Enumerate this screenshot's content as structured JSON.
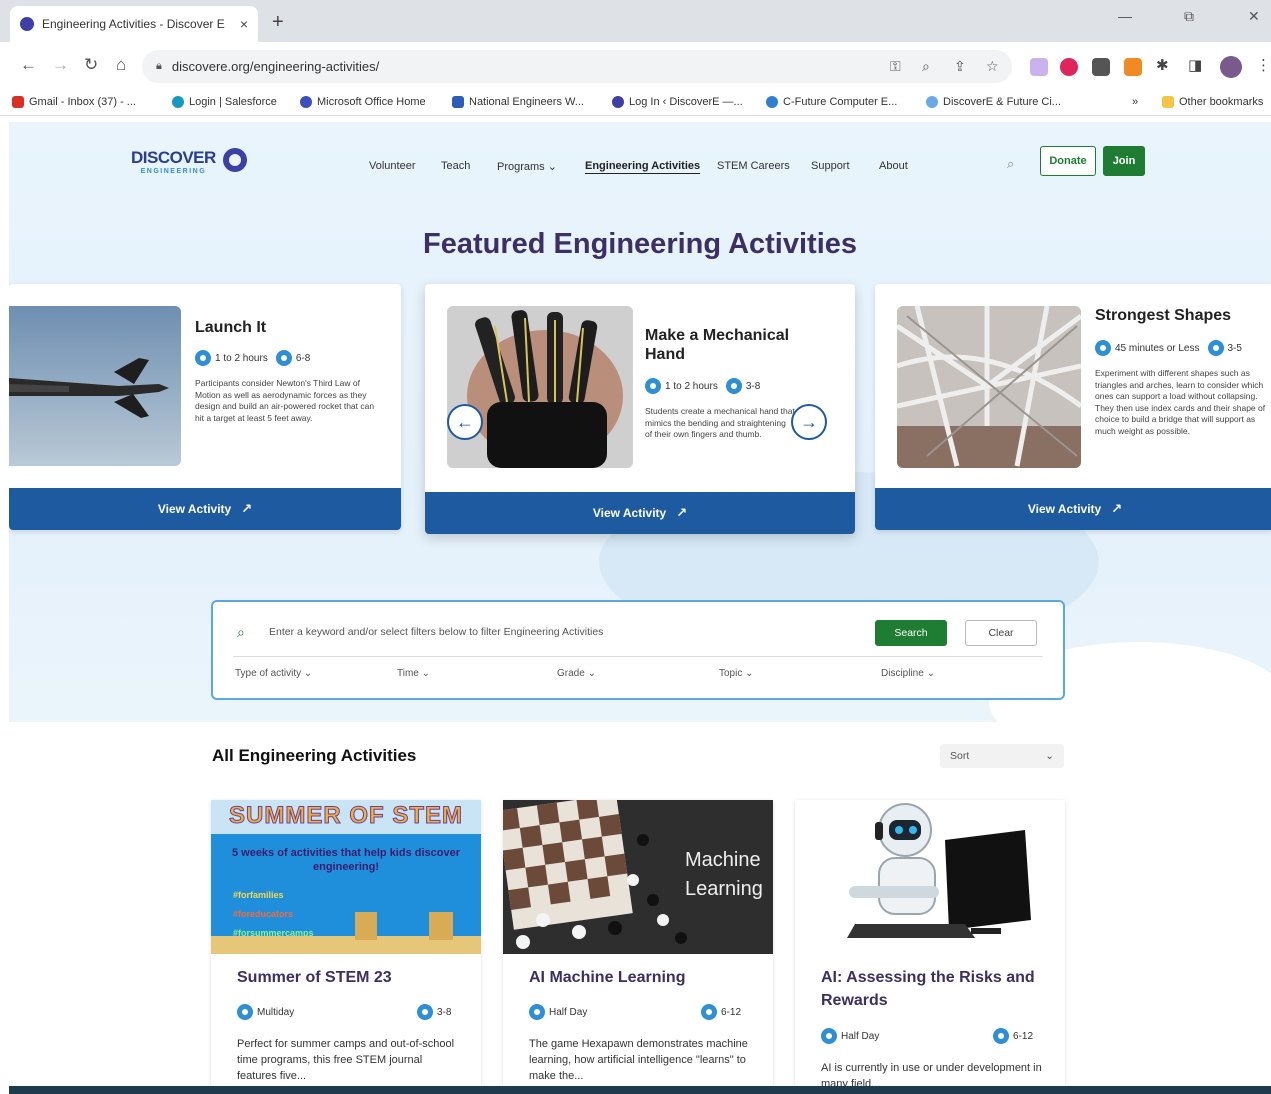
{
  "browser": {
    "tab_title": "Engineering Activities - Discover E",
    "tab_close": "×",
    "new_tab": "+",
    "url": "discovere.org/engineering-activities/",
    "win_minimize": "—",
    "win_restore": "⧉",
    "win_close": "✕",
    "bookmarks": [
      "Gmail - Inbox (37) - ...",
      "Login | Salesforce",
      "Microsoft Office Home",
      "National Engineers W...",
      "Log In ‹ DiscoverE —...",
      "C-Future Computer E...",
      "DiscoverE & Future Ci..."
    ],
    "bookmarks_more": "»",
    "other_bookmarks": "Other bookmarks"
  },
  "site": {
    "logo_word": "DISCOVER",
    "logo_sub": "ENGINEERING",
    "nav": [
      "Volunteer",
      "Teach",
      "Programs ⌄",
      "Engineering Activities",
      "STEM Careers",
      "Support",
      "About"
    ],
    "donate": "Donate",
    "join": "Join"
  },
  "hero": {
    "title": "Featured Engineering Activities"
  },
  "featured": [
    {
      "title": "Launch It",
      "time": "1 to 2 hours",
      "grade": "6-8",
      "desc": "Participants consider Newton's Third Law of Motion as well as aerodynamic forces as they design and build an air-powered rocket that can hit a target at least 5 feet away.",
      "button": "View Activity"
    },
    {
      "title": "Make a Mechanical Hand",
      "time": "1 to 2 hours",
      "grade": "3-8",
      "desc": "Students create a mechanical hand that mimics the bending and straightening of their own fingers and thumb.",
      "button": "View Activity"
    },
    {
      "title": "Strongest Shapes",
      "time": "45 minutes or Less",
      "grade": "3-5",
      "desc": "Experiment with different shapes such as triangles and arches, learn to consider which ones can support a load without collapsing. They then use index cards and their shape of choice to build a bridge that will support as much weight as possible.",
      "button": "View Activity"
    }
  ],
  "filters": {
    "placeholder": "Enter a keyword and/or select filters below to filter Engineering Activities",
    "search_btn": "Search",
    "clear_btn": "Clear",
    "dropdowns": [
      "Type of activity ⌄",
      "Time ⌄",
      "Grade ⌄",
      "Topic ⌄",
      "Discipline ⌄"
    ]
  },
  "all": {
    "title": "All Engineering Activities",
    "sort": "Sort",
    "cards": [
      {
        "img_banner": "SUMMER OF STEM",
        "img_tagline": "5 weeks of activities that help kids discover engineering!",
        "img_lines": [
          "#forfamilies",
          "#foreducators",
          "#forsummercamps"
        ],
        "title": "Summer of STEM 23",
        "time": "Multiday",
        "grade": "3-8",
        "desc": "Perfect for summer camps and out-of-school time programs, this free STEM journal features five..."
      },
      {
        "img_text_1": "Machine",
        "img_text_2": "Learning",
        "title": "AI Machine Learning",
        "time": "Half Day",
        "grade": "6-12",
        "desc": "The game Hexapawn demonstrates machine learning, how artificial intelligence \"learns\" to make the..."
      },
      {
        "title": "AI: Assessing the Risks and Rewards",
        "time": "Half Day",
        "grade": "6-12",
        "desc": "AI is currently in use or under development in many field..."
      }
    ]
  }
}
